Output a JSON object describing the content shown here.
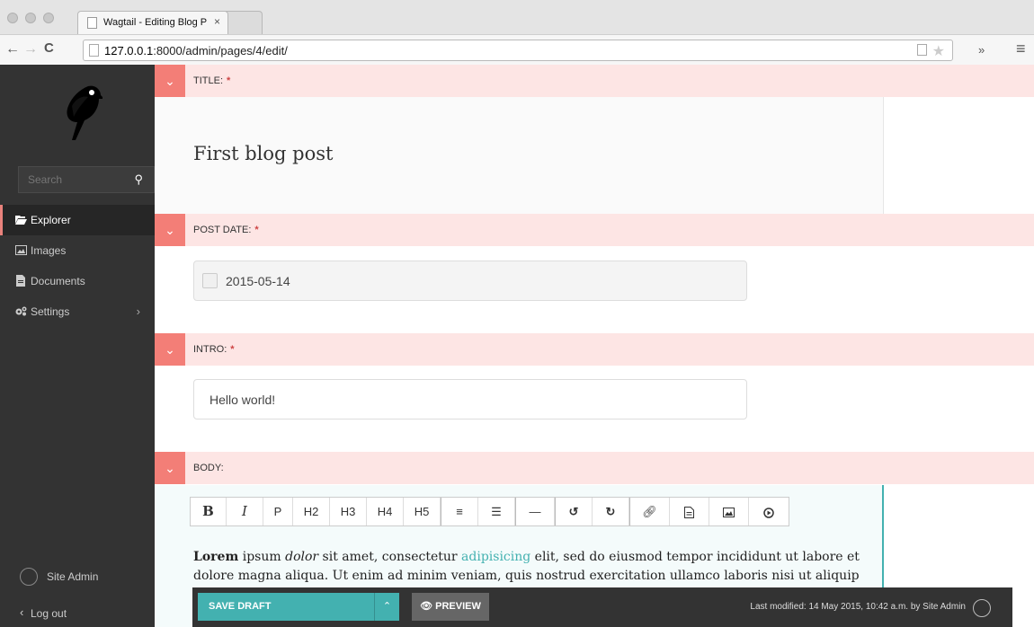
{
  "browser": {
    "tab_title": "Wagtail - Editing Blog Page",
    "url_host": "127.0.0.1",
    "url_rest": ":8000/admin/pages/4/edit/"
  },
  "sidebar": {
    "search_placeholder": "Search",
    "items": [
      {
        "label": "Explorer",
        "icon": "folder-open-icon",
        "active": true
      },
      {
        "label": "Images",
        "icon": "image-icon"
      },
      {
        "label": "Documents",
        "icon": "document-icon"
      },
      {
        "label": "Settings",
        "icon": "cogs-icon"
      }
    ],
    "user_name": "Site Admin",
    "logout": "Log out"
  },
  "fields": {
    "title": {
      "label": "TITLE:",
      "required": "*",
      "value": "First blog post"
    },
    "post_date": {
      "label": "POST DATE:",
      "required": "*",
      "value": "2015-05-14"
    },
    "intro": {
      "label": "INTRO:",
      "required": "*",
      "value": "Hello world!"
    },
    "body": {
      "label": "BODY:",
      "toolbar": [
        "B",
        "I",
        "P",
        "H2",
        "H3",
        "H4",
        "H5",
        "ordered-list-icon",
        "bullet-list-icon",
        "—",
        "undo-icon",
        "redo-icon",
        "link-icon",
        "document-icon",
        "image-icon",
        "embed-icon"
      ],
      "text": {
        "bold": "Lorem",
        "t1": " ipsum ",
        "italic": "dolor",
        "t2": " sit amet, consectetur ",
        "link": "adipisicing",
        "t3": " elit, sed do eiusmod  tempor incididunt ut labore et dolore magna aliqua. Ut enim ad minim veniam,  quis nostrud exercitation ullamco laboris nisi ut aliquip ex"
      }
    }
  },
  "footer": {
    "save_label": "SAVE DRAFT",
    "preview_label": "PREVIEW",
    "last_modified": "Last modified: 14 May 2015, 10:42 a.m. by Site Admin"
  },
  "colors": {
    "accent": "#43b1b0",
    "field_header": "#fde5e4",
    "toggle": "#f37e77",
    "sidebar": "#333333"
  }
}
